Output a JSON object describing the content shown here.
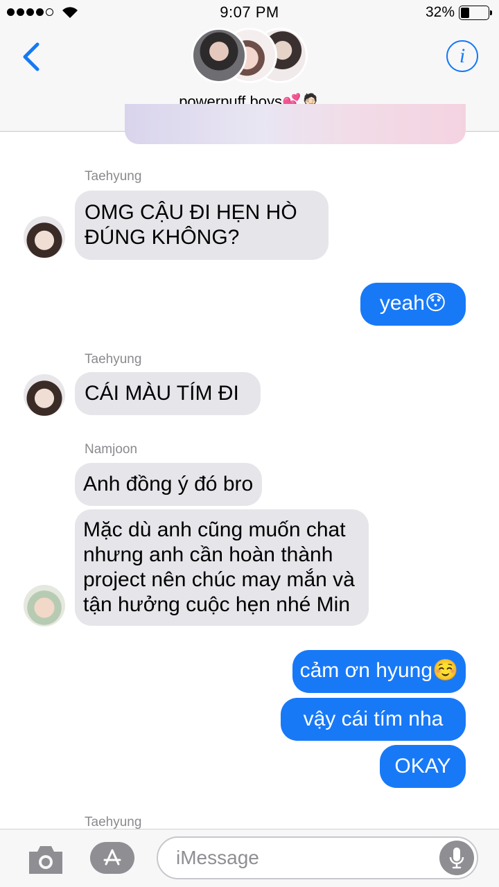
{
  "status": {
    "time": "9:07 PM",
    "battery_text": "32%",
    "battery_level": 0.32
  },
  "header": {
    "group_name": "powerpuff boys",
    "group_name_emoji": "💕🤦🏻",
    "info_icon": "info-icon",
    "back_icon": "chevron-left-icon"
  },
  "messages": [
    {
      "sender": "Taehyung",
      "text": "OMG CẬU ĐI HẸN HÒ ĐÚNG KHÔNG?",
      "direction": "in"
    },
    {
      "text": "yeah😯",
      "direction": "out"
    },
    {
      "sender": "Taehyung",
      "text": "CÁI MÀU TÍM ĐI",
      "direction": "in"
    },
    {
      "sender": "Namjoon",
      "text": "Anh đồng ý đó bro",
      "direction": "in"
    },
    {
      "text": "Mặc dù anh cũng muốn chat nhưng anh cần hoàn thành project nên chúc may mắn và tận hưởng cuộc hẹn nhé Min",
      "direction": "in"
    },
    {
      "text": "cảm ơn hyung☺️",
      "direction": "out"
    },
    {
      "text": "vậy cái tím nha",
      "direction": "out"
    },
    {
      "text": "OKAY",
      "direction": "out"
    },
    {
      "sender": "Taehyung",
      "direction": "in"
    }
  ],
  "composer": {
    "placeholder": "iMessage",
    "camera_icon": "camera-icon",
    "apps_icon": "app-store-icon",
    "mic_icon": "microphone-icon"
  },
  "colors": {
    "accent": "#1479f5",
    "outgoing_bubble": "#1879f7",
    "incoming_bubble": "#e5e5ea"
  }
}
